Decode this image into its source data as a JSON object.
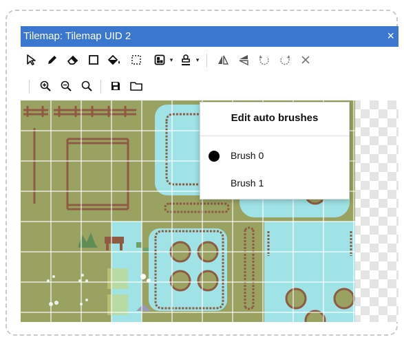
{
  "window": {
    "title": "Tilemap: Tilemap UID 2",
    "close_glyph": "×"
  },
  "toolbar_row1": [
    {
      "icon": "pointer-icon"
    },
    {
      "icon": "pencil-icon"
    },
    {
      "icon": "eraser-icon"
    },
    {
      "icon": "rectangle-icon"
    },
    {
      "icon": "fill-bucket-icon"
    },
    {
      "icon": "selection-icon"
    },
    {
      "icon": "random-brush-icon",
      "caret": "▾"
    },
    {
      "icon": "auto-brush-icon",
      "caret": "▾"
    },
    {
      "icon": "flip-horizontal-icon"
    },
    {
      "icon": "flip-vertical-icon"
    },
    {
      "icon": "rotate-ccw-icon"
    },
    {
      "icon": "rotate-cw-icon"
    },
    {
      "icon": "close-icon"
    }
  ],
  "toolbar_row2": [
    {
      "icon": "zoom-in-icon"
    },
    {
      "icon": "zoom-out-icon"
    },
    {
      "icon": "zoom-reset-icon"
    },
    {
      "icon": "save-icon"
    },
    {
      "icon": "folder-icon"
    }
  ],
  "dropdown": {
    "title": "Edit auto brushes",
    "items": [
      {
        "label": "Brush 0",
        "selected": true
      },
      {
        "label": "Brush 1",
        "selected": false
      }
    ]
  },
  "colors": {
    "titlebar": "#3a78d0",
    "grass": "#9aa262",
    "water": "#9fe3e6",
    "fence": "#8e5a42",
    "grid": "#ffffff"
  }
}
